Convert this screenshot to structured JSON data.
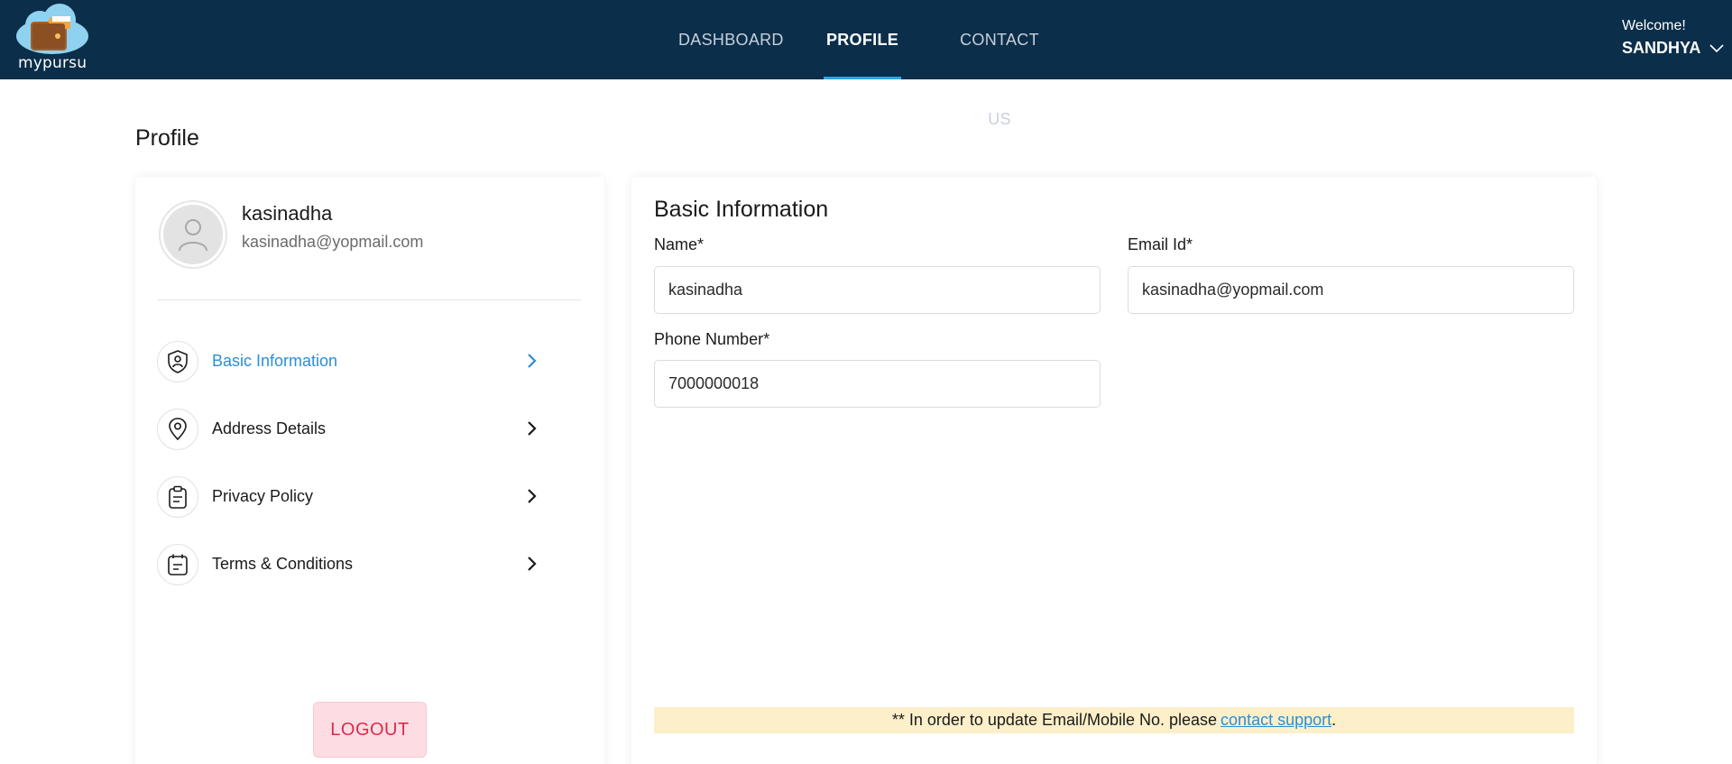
{
  "brand": {
    "name": "mypursu"
  },
  "nav": {
    "items": [
      "DASHBOARD",
      "PROFILE",
      "CONTACT US"
    ],
    "active": "PROFILE"
  },
  "user": {
    "welcome": "Welcome!",
    "name": "SANDHYA"
  },
  "page": {
    "title": "Profile"
  },
  "profile": {
    "name": "kasinadha",
    "email": "kasinadha@yopmail.com"
  },
  "menu": [
    {
      "label": "Basic Information",
      "icon": "user-shield-icon",
      "active": true
    },
    {
      "label": "Address Details",
      "icon": "location-pin-icon",
      "active": false
    },
    {
      "label": "Privacy Policy",
      "icon": "clipboard-icon",
      "active": false
    },
    {
      "label": "Terms & Conditions",
      "icon": "calendar-doc-icon",
      "active": false
    }
  ],
  "logout": "LOGOUT",
  "basic_info": {
    "title": "Basic Information",
    "name_label": "Name*",
    "name_value": "kasinadha",
    "email_label": "Email Id*",
    "email_value": "kasinadha@yopmail.com",
    "phone_label": "Phone Number*",
    "phone_value": "7000000018"
  },
  "notice": {
    "text": "** In order to update Email/Mobile No. please",
    "link": "contact support",
    "suffix": "."
  },
  "colors": {
    "header": "#0b2e4a",
    "accent": "#2a8fd6",
    "logout": "#e02a4a",
    "notice_bg": "#fdefc9"
  }
}
